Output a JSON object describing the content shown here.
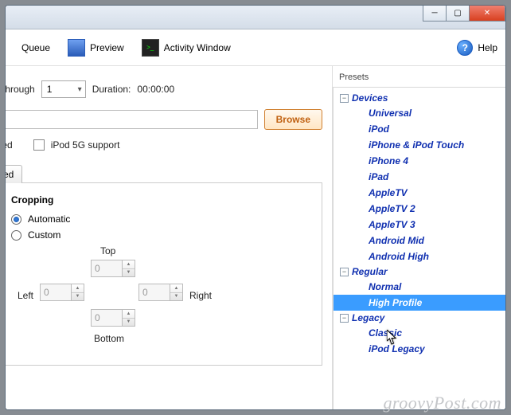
{
  "toolbar": {
    "queue_label": "Queue",
    "preview_label": "Preview",
    "activity_label": "Activity Window",
    "help_label": "Help"
  },
  "range": {
    "through_label": "through",
    "through_value": "1",
    "duration_label": "Duration:",
    "duration_value": "00:00:00"
  },
  "file": {
    "browse_label": "Browse"
  },
  "options": {
    "nized_partial": "nized",
    "ipod5g_label": "iPod 5G support",
    "tab_partial": "ed"
  },
  "cropping": {
    "heading": "Cropping",
    "automatic": "Automatic",
    "custom": "Custom",
    "top": "Top",
    "bottom": "Bottom",
    "left": "Left",
    "right": "Right",
    "val_top": "0",
    "val_bottom": "0",
    "val_left": "0",
    "val_right": "0"
  },
  "presets": {
    "panel_title": "Presets",
    "groups": [
      {
        "name": "Devices",
        "items": [
          "Universal",
          "iPod",
          "iPhone & iPod Touch",
          "iPhone 4",
          "iPad",
          "AppleTV",
          "AppleTV 2",
          "AppleTV 3",
          "Android Mid",
          "Android High"
        ]
      },
      {
        "name": "Regular",
        "items": [
          "Normal",
          "High Profile"
        ]
      },
      {
        "name": "Legacy",
        "items": [
          "Classic",
          "iPod Legacy"
        ]
      }
    ],
    "selected": "High Profile"
  },
  "watermark": "groovyPost.com"
}
